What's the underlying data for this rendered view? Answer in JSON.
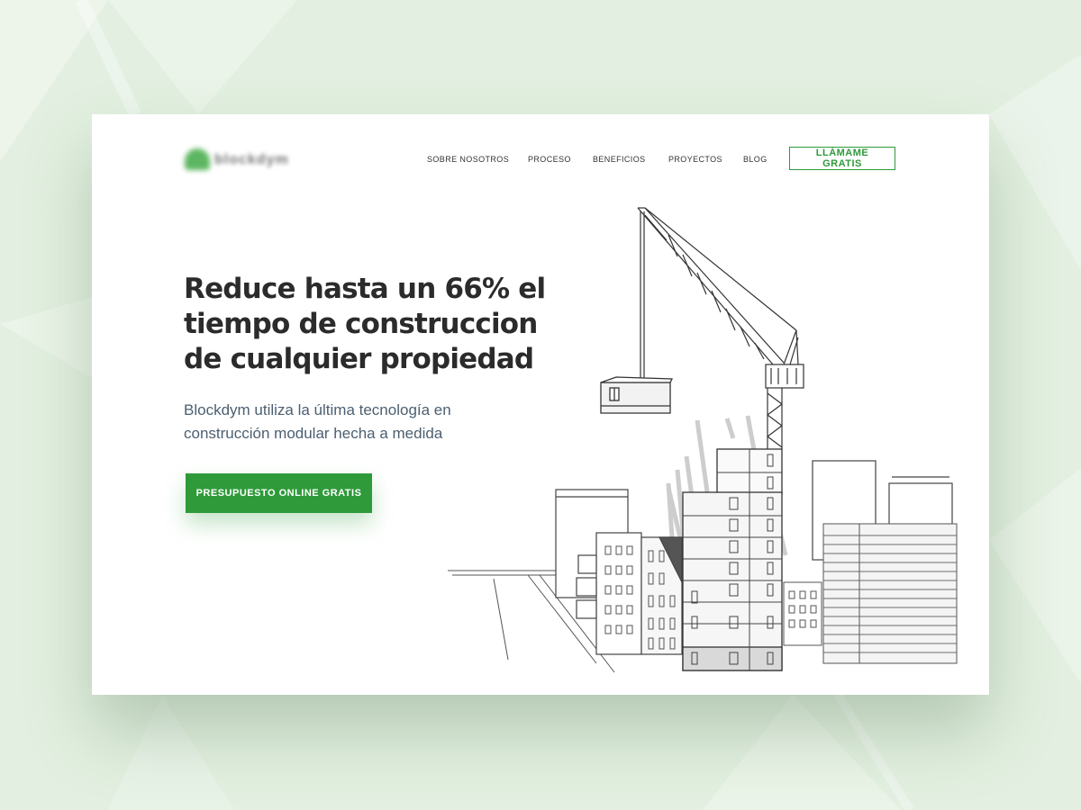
{
  "header": {
    "logo_text": "blockdym",
    "nav": [
      {
        "label": "SOBRE NOSOTROS"
      },
      {
        "label": "PROCESO"
      },
      {
        "label": "BENEFICIOS"
      },
      {
        "label": "PROYECTOS"
      },
      {
        "label": "BLOG"
      }
    ],
    "cta_label": "LLÁMAME GRATIS"
  },
  "hero": {
    "title": "Reduce hasta un 66% el tiempo de construccion de cualquier propiedad",
    "subtitle": "Blockdym utiliza la última tecnología en construcción modular hecha a medida",
    "cta_label": "PRESUPUESTO ONLINE GRATIS"
  },
  "colors": {
    "accent": "#2e9a3a",
    "background": "#e3f0e1",
    "heading": "#2b2b2b",
    "body_text": "#4c5f70"
  },
  "icons": {
    "logo": "leaf-logo-mark",
    "illustration": "crane-city-sketch"
  }
}
